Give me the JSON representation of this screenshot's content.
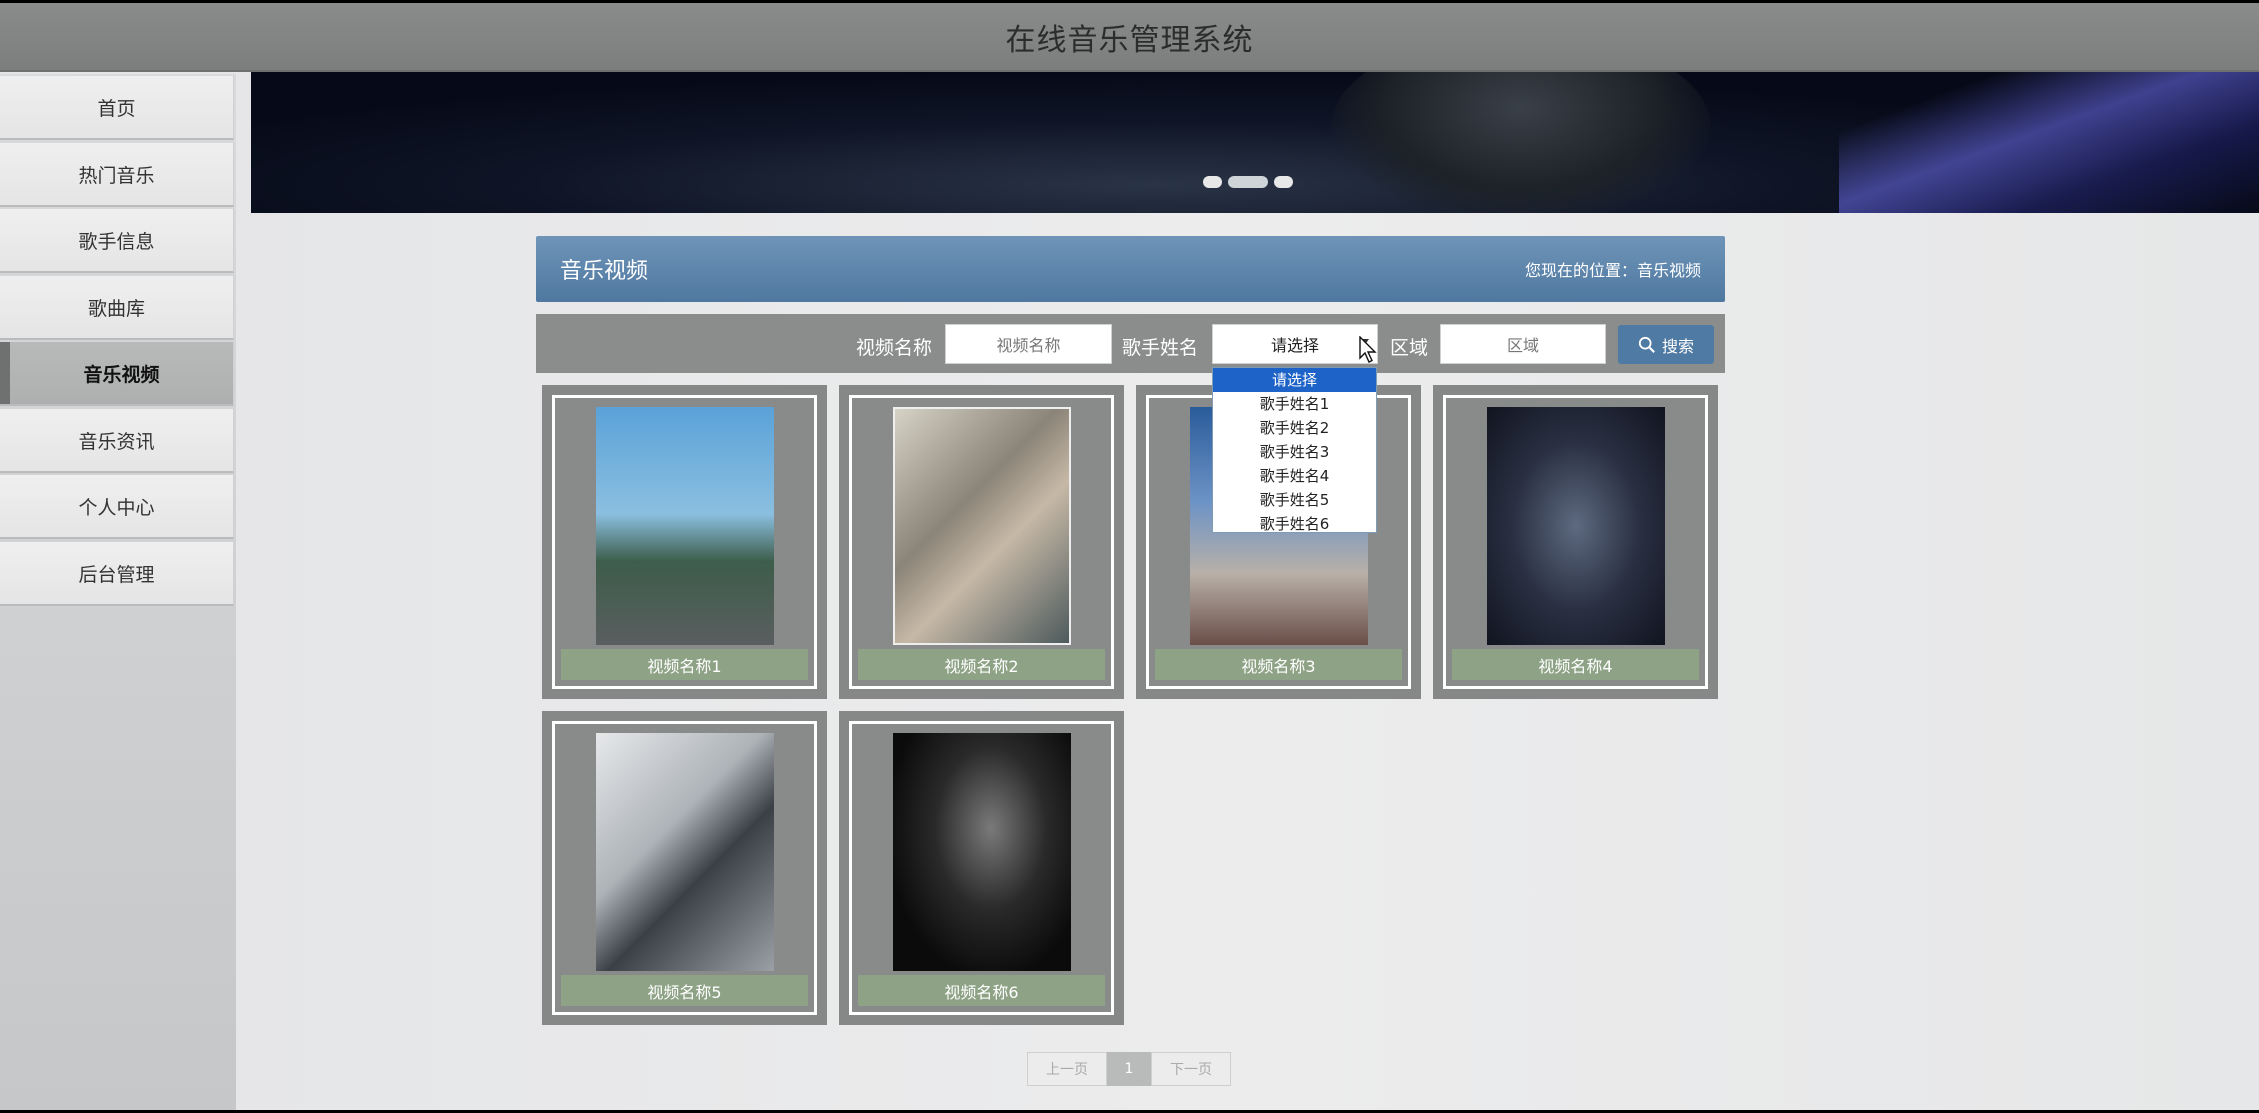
{
  "header": {
    "title": "在线音乐管理系统"
  },
  "sidebar": {
    "items": [
      {
        "label": "首页"
      },
      {
        "label": "热门音乐"
      },
      {
        "label": "歌手信息"
      },
      {
        "label": "歌曲库"
      },
      {
        "label": "音乐视频",
        "active": true
      },
      {
        "label": "音乐资讯"
      },
      {
        "label": "个人中心"
      },
      {
        "label": "后台管理"
      }
    ]
  },
  "banner": {
    "slides": 3,
    "active_slide": 2
  },
  "section": {
    "title": "音乐视频",
    "location": "您现在的位置：音乐视频"
  },
  "search": {
    "video_name_label": "视频名称",
    "video_name_placeholder": "视频名称",
    "singer_label": "歌手姓名",
    "singer_selected": "请选择",
    "region_label": "区域",
    "region_placeholder": "区域",
    "button_label": "搜索"
  },
  "dropdown": {
    "options": [
      "请选择",
      "歌手姓名1",
      "歌手姓名2",
      "歌手姓名3",
      "歌手姓名4",
      "歌手姓名5",
      "歌手姓名6"
    ],
    "selected_index": 0
  },
  "videos": [
    {
      "name": "视频名称1"
    },
    {
      "name": "视频名称2"
    },
    {
      "name": "视频名称3"
    },
    {
      "name": "视频名称4"
    },
    {
      "name": "视频名称5"
    },
    {
      "name": "视频名称6"
    }
  ],
  "pagination": {
    "prev": "上一页",
    "current": "1",
    "next": "下一页"
  },
  "colors": {
    "accent": "#4f7aa3",
    "caption": "#8ea286",
    "dropdown_selected": "#1e63c8"
  }
}
